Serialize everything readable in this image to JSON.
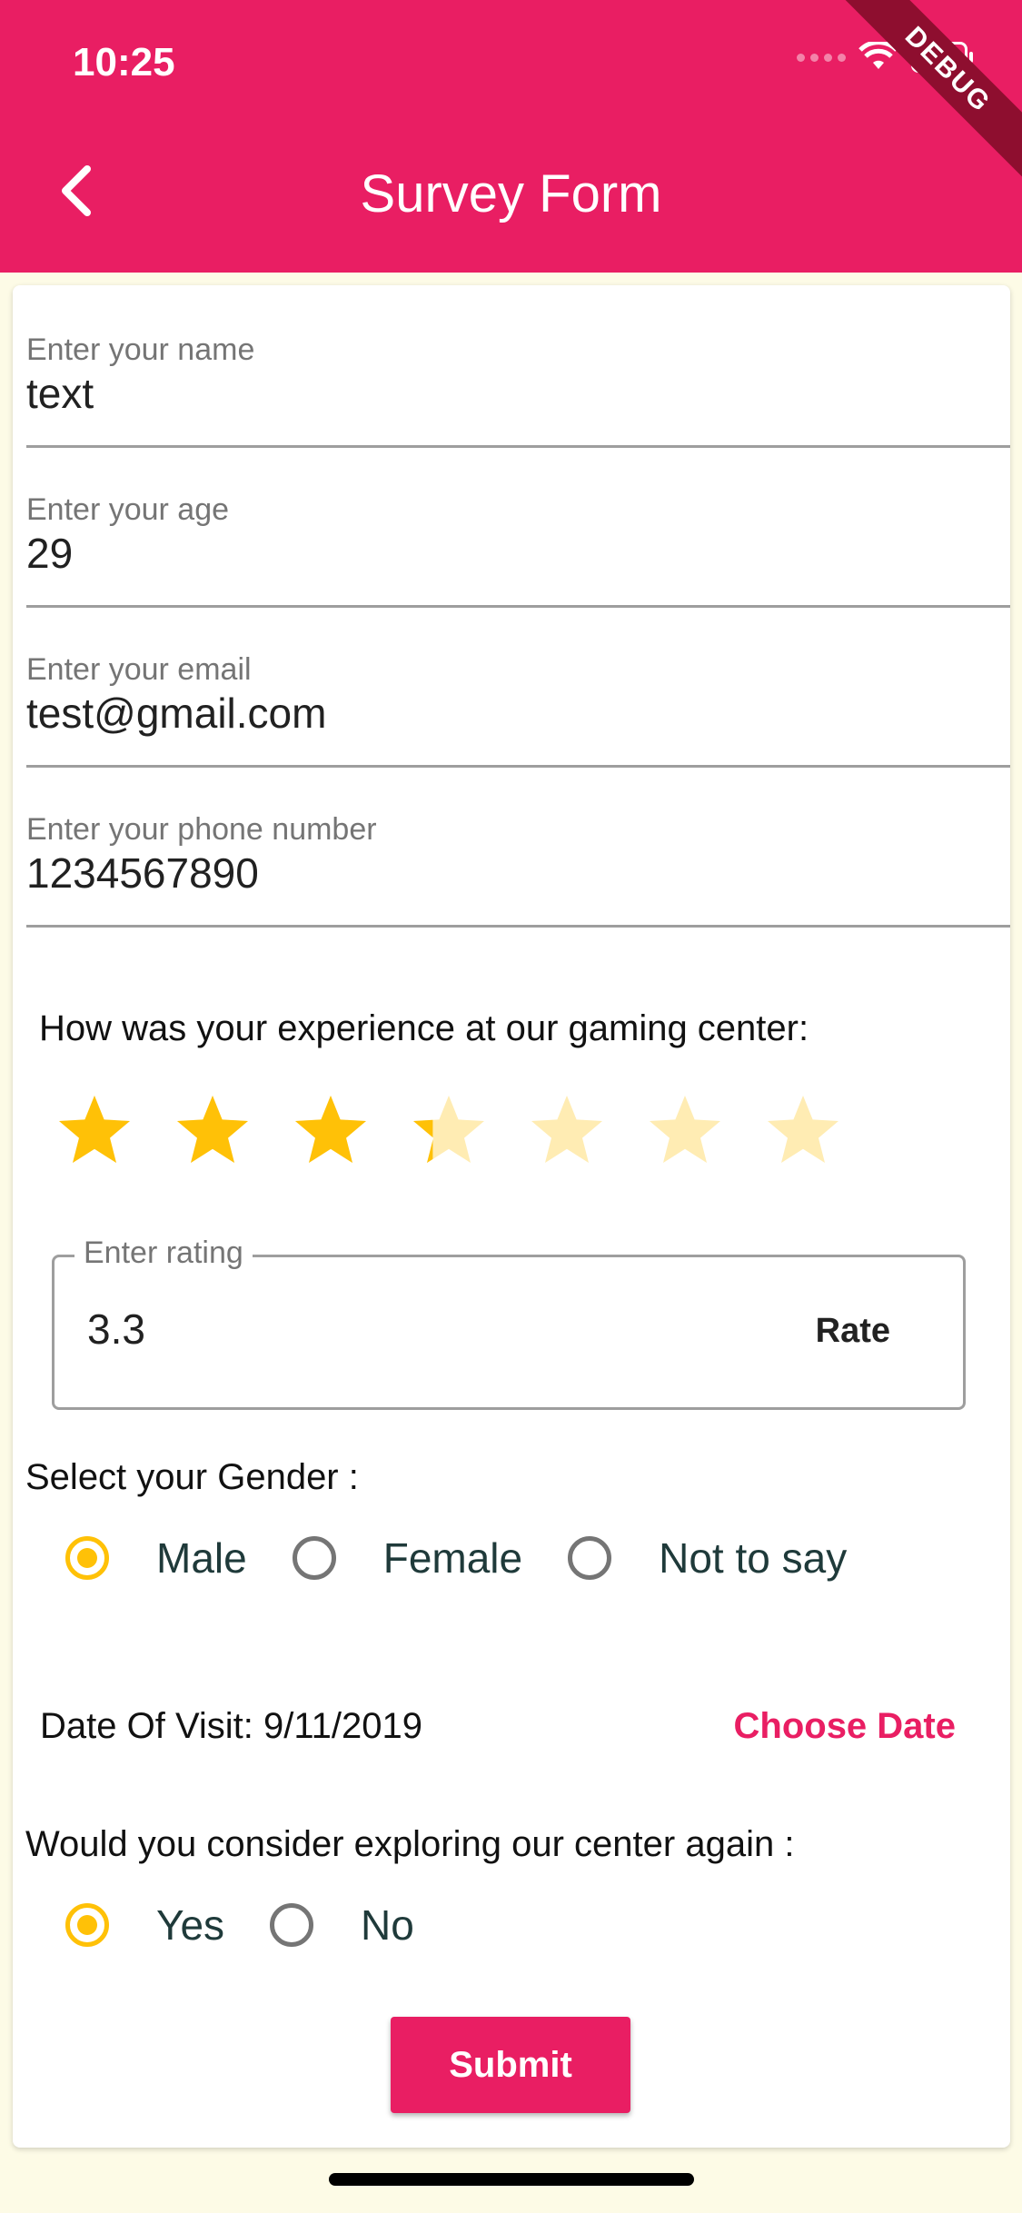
{
  "status_bar": {
    "time": "10:25"
  },
  "debug_banner": "DEBUG",
  "app_bar": {
    "title": "Survey Form"
  },
  "fields": [
    {
      "label": "Enter your name",
      "value": "text"
    },
    {
      "label": "Enter your age",
      "value": "29"
    },
    {
      "label": "Enter your email",
      "value": "test@gmail.com"
    },
    {
      "label": "Enter your phone number",
      "value": "1234567890"
    }
  ],
  "experience": {
    "question": "How was your experience at our gaming center:",
    "stars_total": 7,
    "rating": 3.3,
    "rating_input": {
      "label": "Enter rating",
      "value": "3.3"
    },
    "rate_button": "Rate"
  },
  "gender": {
    "question": "Select your Gender :",
    "options": [
      "Male",
      "Female",
      "Not to say"
    ],
    "selected": "Male"
  },
  "visit": {
    "label": "Date Of Visit: 9/11/2019",
    "choose_date": "Choose Date"
  },
  "again": {
    "question": "Would you consider exploring our center again :",
    "options": [
      "Yes",
      "No"
    ],
    "selected": "Yes"
  },
  "submit_label": "Submit",
  "colors": {
    "primary": "#e91e63",
    "star": "#ffc107",
    "background": "#fdfbe6"
  }
}
